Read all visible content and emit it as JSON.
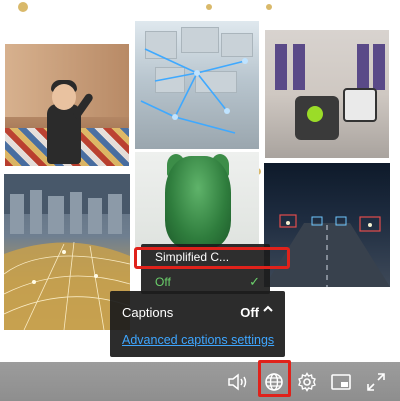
{
  "captions_menu": {
    "items": [
      {
        "label": "Simplified C..."
      },
      {
        "label": "Off",
        "selected": true
      }
    ],
    "selected_check": "✓"
  },
  "captions_panel": {
    "label": "Captions",
    "value": "Off",
    "chevron": "^",
    "advanced_link": "Advanced captions settings"
  },
  "toolbar": {
    "buttons": [
      {
        "icon": "volume-icon"
      },
      {
        "icon": "globe-icon",
        "highlighted": true
      },
      {
        "icon": "gear-icon"
      },
      {
        "icon": "picture-in-picture-icon"
      },
      {
        "icon": "fullscreen-icon"
      }
    ]
  },
  "colors": {
    "highlight": "#e0221b",
    "selected_text": "#6bd06b",
    "link": "#3ea6ff",
    "toolbar_bg": "#969696"
  }
}
